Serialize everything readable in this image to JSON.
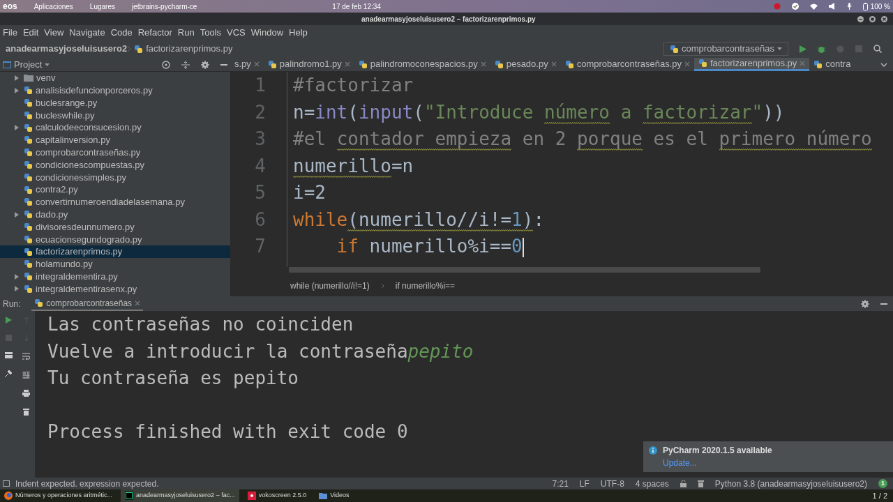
{
  "system_bar": {
    "logo": "eos",
    "menus": [
      "Aplicaciones",
      "Lugares",
      "jetbrains-pycharm-ce"
    ],
    "clock": "17 de feb 12:34",
    "battery": "100 %"
  },
  "window": {
    "title": "anadearmasyjoseluisusero2 – factorizarenprimos.py"
  },
  "menu": [
    "File",
    "Edit",
    "View",
    "Navigate",
    "Code",
    "Refactor",
    "Run",
    "Tools",
    "VCS",
    "Window",
    "Help"
  ],
  "breadcrumb": [
    "anadearmasyjoseluisusero2",
    "factorizarenprimos.py"
  ],
  "run_config": "comprobarcontraseñas",
  "project_panel": {
    "title": "Project",
    "items": [
      {
        "label": "venv",
        "kind": "folder",
        "expandable": true,
        "selected": false
      },
      {
        "label": "analisisdefuncionporceros.py",
        "kind": "file",
        "expandable": true,
        "selected": false
      },
      {
        "label": "buclesrange.py",
        "kind": "file",
        "expandable": false,
        "selected": false
      },
      {
        "label": "bucleswhile.py",
        "kind": "file",
        "expandable": false,
        "selected": false
      },
      {
        "label": "calculodeeconsucesion.py",
        "kind": "file",
        "expandable": true,
        "selected": false
      },
      {
        "label": "capitalinversion.py",
        "kind": "file",
        "expandable": false,
        "selected": false
      },
      {
        "label": "comprobarcontraseñas.py",
        "kind": "file",
        "expandable": false,
        "selected": false
      },
      {
        "label": "condicionescompuestas.py",
        "kind": "file",
        "expandable": false,
        "selected": false
      },
      {
        "label": "condicionessimples.py",
        "kind": "file",
        "expandable": false,
        "selected": false
      },
      {
        "label": "contra2.py",
        "kind": "file",
        "expandable": false,
        "selected": false
      },
      {
        "label": "convertirnumeroendiadelasemana.py",
        "kind": "file",
        "expandable": false,
        "selected": false
      },
      {
        "label": "dado.py",
        "kind": "file",
        "expandable": true,
        "selected": false
      },
      {
        "label": "divisoresdeunnumero.py",
        "kind": "file",
        "expandable": false,
        "selected": false
      },
      {
        "label": "ecuacionsegundogrado.py",
        "kind": "file",
        "expandable": false,
        "selected": false
      },
      {
        "label": "factorizarenprimos.py",
        "kind": "file",
        "expandable": false,
        "selected": true
      },
      {
        "label": "holamundo.py",
        "kind": "file",
        "expandable": false,
        "selected": false
      },
      {
        "label": "integraldementira.py",
        "kind": "file",
        "expandable": true,
        "selected": false
      },
      {
        "label": "integraldementirasenx.py",
        "kind": "file",
        "expandable": true,
        "selected": false
      }
    ]
  },
  "tabs": [
    {
      "label": "s.py",
      "selected": false,
      "closable": true
    },
    {
      "label": "palindromo1.py",
      "selected": false,
      "closable": true
    },
    {
      "label": "palindromoconespacios.py",
      "selected": false,
      "closable": true
    },
    {
      "label": "pesado.py",
      "selected": false,
      "closable": true
    },
    {
      "label": "comprobarcontraseñas.py",
      "selected": false,
      "closable": true
    },
    {
      "label": "factorizarenprimos.py",
      "selected": true,
      "closable": true
    },
    {
      "label": "contra",
      "selected": false,
      "closable": false
    }
  ],
  "editor": {
    "lines": [
      {
        "number": "1",
        "segments": [
          {
            "text": "#factorizar",
            "kind": "comment",
            "warn": false
          }
        ]
      },
      {
        "number": "2",
        "segments": [
          {
            "text": "n=",
            "kind": "plain",
            "warn": false
          },
          {
            "text": "int",
            "kind": "builtin",
            "warn": false
          },
          {
            "text": "(",
            "kind": "plain",
            "warn": false
          },
          {
            "text": "input",
            "kind": "builtin",
            "warn": false
          },
          {
            "text": "(",
            "kind": "plain",
            "warn": false
          },
          {
            "text": "\"Introduce ",
            "kind": "string",
            "warn": false
          },
          {
            "text": "número",
            "kind": "string",
            "warn": true
          },
          {
            "text": " a ",
            "kind": "string",
            "warn": false
          },
          {
            "text": "factorizar",
            "kind": "string",
            "warn": true
          },
          {
            "text": "\"",
            "kind": "string",
            "warn": false
          },
          {
            "text": "))",
            "kind": "plain",
            "warn": false
          }
        ]
      },
      {
        "number": "3",
        "segments": [
          {
            "text": "#el ",
            "kind": "comment",
            "warn": false
          },
          {
            "text": "contador",
            "kind": "comment",
            "warn": true
          },
          {
            "text": " empieza",
            "kind": "comment",
            "warn": true
          },
          {
            "text": " en 2 ",
            "kind": "comment",
            "warn": false
          },
          {
            "text": "porque",
            "kind": "comment",
            "warn": true
          },
          {
            "text": " es el ",
            "kind": "comment",
            "warn": false
          },
          {
            "text": "primero",
            "kind": "comment",
            "warn": true
          },
          {
            "text": " número",
            "kind": "comment",
            "warn": true
          }
        ]
      },
      {
        "number": "4",
        "segments": [
          {
            "text": "numerillo",
            "kind": "plain",
            "warn": true
          },
          {
            "text": "=n",
            "kind": "plain",
            "warn": false
          }
        ]
      },
      {
        "number": "5",
        "segments": [
          {
            "text": "i=2",
            "kind": "plain",
            "warn": false
          }
        ]
      },
      {
        "number": "6",
        "segments": [
          {
            "text": "while",
            "kind": "keyword",
            "warn": false
          },
          {
            "text": "(numerillo//i!=",
            "kind": "plain",
            "warn": true
          },
          {
            "text": "1",
            "kind": "number",
            "warn": true
          },
          {
            "text": ")",
            "kind": "plain",
            "warn": true
          },
          {
            "text": ":",
            "kind": "plain",
            "warn": false
          }
        ]
      },
      {
        "number": "7",
        "segments": [
          {
            "text": "    if",
            "kind": "keyword",
            "warn": false
          },
          {
            "text": " numerillo%i==",
            "kind": "plain",
            "warn": false
          },
          {
            "text": "0",
            "kind": "number",
            "warn": false
          }
        ]
      }
    ]
  },
  "code_breadcrumbs": [
    "while (numerillo//i!=1)",
    "if numerillo%i=="
  ],
  "run_panel": {
    "label": "Run:",
    "config": "comprobarcontraseñas",
    "console": [
      {
        "spaced": false,
        "segments": [
          {
            "text": "Las contraseñas no coinciden",
            "kind": "output"
          }
        ]
      },
      {
        "spaced": false,
        "segments": [
          {
            "text": "Vuelve a introducir la contraseña",
            "kind": "output"
          },
          {
            "text": "pepito",
            "kind": "input"
          }
        ]
      },
      {
        "spaced": false,
        "segments": [
          {
            "text": "Tu contraseña es pepito",
            "kind": "output"
          }
        ]
      },
      {
        "spaced": true,
        "segments": [
          {
            "text": "Process finished with exit code 0",
            "kind": "output"
          }
        ]
      }
    ]
  },
  "notification": {
    "title": "PyCharm 2020.1.5 available",
    "link": "Update..."
  },
  "status_bar": {
    "message": "Indent expected. expression expected.",
    "items": [
      "7:21",
      "LF",
      "UTF-8",
      "4 spaces"
    ],
    "interpreter": "Python 3.8 (anadearmasyjoseluisusero2)",
    "badge": "1"
  },
  "taskbar": {
    "items": [
      {
        "label": "Números y operaciones aritmétic...",
        "kind": "browser",
        "selected": false
      },
      {
        "label": "anadearmasyjoseluisusero2 – fac...",
        "kind": "ide",
        "selected": true
      },
      {
        "label": "vokoscreen 2.5.0",
        "kind": "recorder",
        "selected": false
      },
      {
        "label": "Videos",
        "kind": "folder",
        "selected": false
      }
    ],
    "pager": "1 / 2"
  }
}
